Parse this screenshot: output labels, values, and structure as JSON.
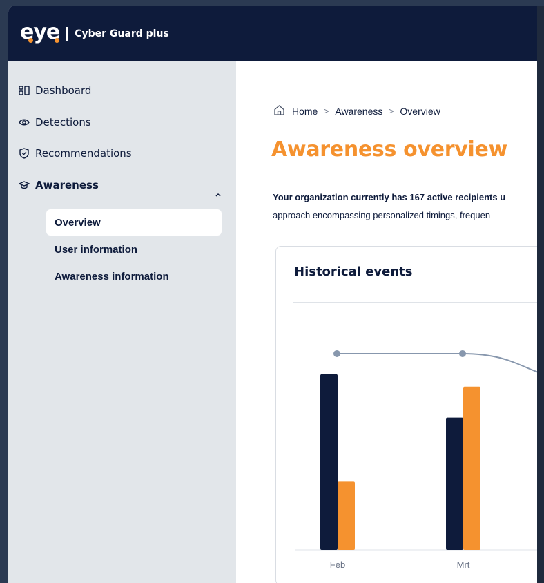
{
  "app": {
    "logo_text": "eye",
    "product_name": "Cyber Guard plus"
  },
  "sidebar": {
    "items": [
      {
        "label": "Dashboard",
        "icon": "dashboard-icon"
      },
      {
        "label": "Detections",
        "icon": "eye-icon"
      },
      {
        "label": "Recommendations",
        "icon": "shield-check-icon"
      },
      {
        "label": "Awareness",
        "icon": "graduation-cap-icon",
        "expanded": true
      }
    ],
    "subitems": [
      {
        "label": "Overview",
        "active": true
      },
      {
        "label": "User information",
        "active": false
      },
      {
        "label": "Awareness information",
        "active": false
      }
    ]
  },
  "breadcrumb": {
    "items": [
      "Home",
      "Awareness",
      "Overview"
    ]
  },
  "page": {
    "title": "Awareness overview",
    "description_bold": "Your organization currently has 167 active recipients u",
    "description_rest": "approach encompassing personalized timings, frequen"
  },
  "card": {
    "title": "Historical events"
  },
  "colors": {
    "navy": "#0e1b3b",
    "orange": "#f5922f",
    "line": "#8797ad",
    "sidebar_bg": "#e2e6ea"
  },
  "chart_data": {
    "type": "bar",
    "categories": [
      "Feb",
      "Mrt"
    ],
    "series": [
      {
        "values": [
          85,
          64
        ],
        "color": "#0e1b3b"
      },
      {
        "values": [
          33,
          79
        ],
        "color": "#f5922f"
      }
    ],
    "line_series": {
      "values": [
        95,
        95,
        82
      ],
      "color": "#8797ad"
    },
    "ylim": [
      0,
      100
    ],
    "grid": false,
    "legend": "none",
    "title": "Historical events"
  }
}
